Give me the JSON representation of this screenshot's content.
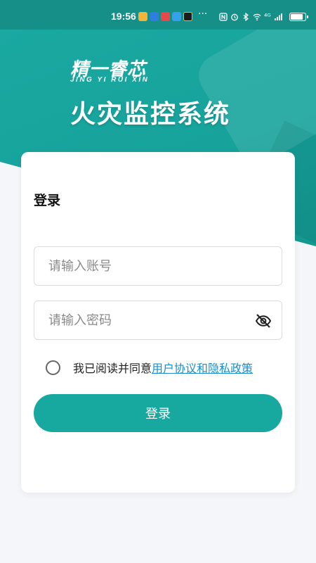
{
  "status_bar": {
    "time": "19:56",
    "more": "···",
    "signal_label": "⁴ᴳ",
    "app_colors": [
      "#f3b43a",
      "#2f7de0",
      "#e84848",
      "#34a2ea",
      "#1c1c1c"
    ]
  },
  "brand": {
    "logo": "精一睿芯",
    "logo_sub": "JING YI RUI XIN",
    "app_title": "火灾监控系统"
  },
  "login": {
    "title": "登录",
    "account_placeholder": "请输入账号",
    "password_placeholder": "请输入密码",
    "agree_text": "我已阅读并同意",
    "agree_link": "用户协议和隐私政策",
    "submit_label": "登录",
    "accent": "#17a89f"
  },
  "colors": {
    "header_teal": "#17a39c",
    "status_bar": "#168f89",
    "link": "#1a8fc9"
  },
  "icons": {
    "password_toggle": "eye-off-icon"
  }
}
